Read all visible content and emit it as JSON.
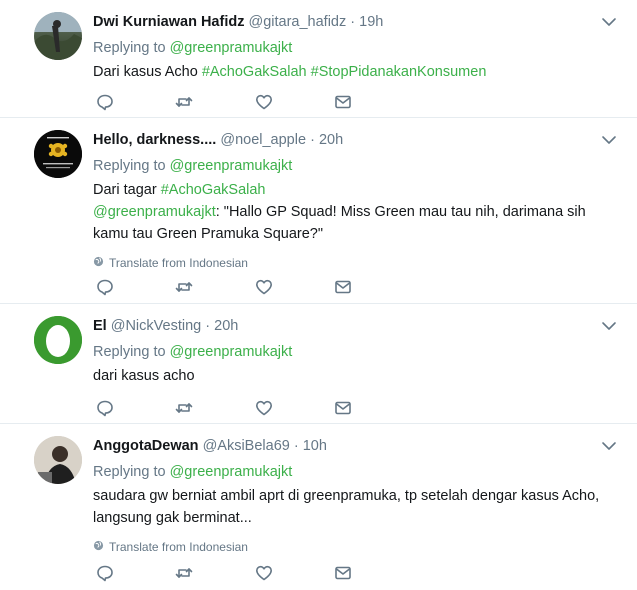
{
  "tweets": [
    {
      "name": "Dwi Kurniawan Hafidz",
      "handle": "@gitara_hafidz",
      "dot": "·",
      "time": "19h",
      "replying_label": "Replying to ",
      "replying_handle": "@greenpramukajkt",
      "lines": [
        {
          "text": "Dari kasus Acho ",
          "links": [
            "#AchoGakSalah",
            " ",
            "#StopPidanakanKonsumen"
          ]
        }
      ]
    },
    {
      "name": "Hello, darkness....",
      "handle": "@noel_apple",
      "dot": "·",
      "time": "20h",
      "replying_label": "Replying to ",
      "replying_handle": "@greenpramukajkt",
      "line1_text": "Dari tagar ",
      "line1_link": "#AchoGakSalah",
      "line2_link": "@greenpramukajkt",
      "line2_text": ": \"Hallo GP Squad! Miss Green mau tau nih, darimana sih",
      "line3_text": "kamu tau Green Pramuka Square?\"",
      "translate": "Translate from Indonesian"
    },
    {
      "name": "El",
      "handle": "@NickVesting",
      "dot": "·",
      "time": "20h",
      "replying_label": "Replying to ",
      "replying_handle": "@greenpramukajkt",
      "text": "dari kasus acho"
    },
    {
      "name": "AnggotaDewan",
      "handle": "@AksiBela69",
      "dot": "·",
      "time": "10h",
      "replying_label": "Replying to ",
      "replying_handle": "@greenpramukajkt",
      "line1_text": "saudara gw berniat ambil aprt di greenpramuka,  tp setelah dengar kasus Acho,",
      "line2_text": "langsung gak berminat...",
      "translate": "Translate from Indonesian"
    }
  ],
  "tweet1_link1": "#AchoGakSalah",
  "tweet1_link2": "#StopPidanakanKonsumen",
  "tweet1_text": "Dari kasus Acho ",
  "colors": {
    "link": "#3cb04a",
    "muted": "#657786",
    "divider": "#e6ecf0"
  },
  "icons": [
    "reply-icon",
    "retweet-icon",
    "like-icon",
    "dm-icon",
    "chevron-down-icon",
    "globe-icon"
  ]
}
